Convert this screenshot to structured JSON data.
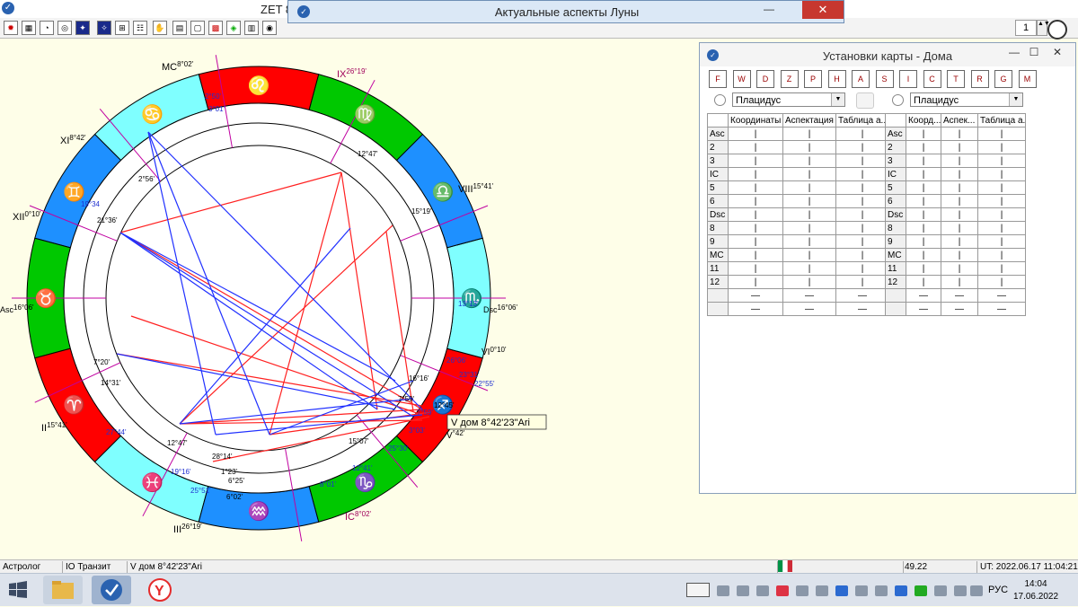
{
  "app": {
    "title": "ZET 8",
    "page_number": "1"
  },
  "moon_window": {
    "title": "Актуальные аспекты Луны",
    "close": "✕",
    "minimize": "—"
  },
  "houses_window": {
    "title": "Установки карты - Дома",
    "minimize": "—",
    "maximize": "☐",
    "close": "✕",
    "buttons": [
      "F",
      "W",
      "D",
      "Z",
      "P",
      "H",
      "A",
      "S",
      "I",
      "C",
      "T",
      "R",
      "G",
      "M"
    ],
    "system_left": "Плацидус",
    "system_right": "Плацидус",
    "left_headers": [
      "Координаты",
      "Аспектация",
      "Таблица а..."
    ],
    "right_headers": [
      "Коорд...",
      "Аспек...",
      "Таблица а..."
    ],
    "rows": [
      "Asc",
      "2",
      "3",
      "IC",
      "5",
      "6",
      "Dsc",
      "8",
      "9",
      "MC",
      "11",
      "12",
      "",
      ""
    ],
    "tick": "|",
    "dash": "—"
  },
  "chart": {
    "cusps": {
      "mc": "MC",
      "mc_deg": "8°02'",
      "ix": "IX",
      "ix_deg": "26°19'",
      "xi": "XI",
      "xi_deg": "8°42'",
      "viii": "VIII",
      "viii_deg": "15°41'",
      "xii": "XII",
      "xii_deg": "0°10'",
      "asc": "Asc",
      "asc_deg": "16°06'",
      "dsc": "Dsc",
      "dsc_deg": "16°06'",
      "vi": "VI",
      "vi_deg": "0°10'",
      "ii": "II",
      "ii_deg": "15°41'",
      "iii": "III",
      "iii_deg": "26°19'",
      "ic": "IC",
      "ic_deg": "8°02'",
      "v": "V",
      "v_deg": "°42'"
    },
    "planet_labels": [
      {
        "text": "2°50'",
        "color": "#1f2fd0"
      },
      {
        "text": "3°01'",
        "color": "#1f2fd0"
      },
      {
        "text": "2°56'",
        "color": "#000"
      },
      {
        "text": "19°34",
        "color": "#1f2fd0"
      },
      {
        "text": "21°36'",
        "color": "#000"
      },
      {
        "text": "12°47'",
        "color": "#000"
      },
      {
        "text": "15°19'",
        "color": "#000"
      },
      {
        "text": "13°13'",
        "color": "#1f2fd0"
      },
      {
        "text": "26°06'",
        "color": "#1f2fd0"
      },
      {
        "text": "23°31'",
        "color": "#1f2fd0"
      },
      {
        "text": "22°55'",
        "color": "#1f2fd0"
      },
      {
        "text": "16°16'",
        "color": "#000"
      },
      {
        "text": "7°59'",
        "color": "#000"
      },
      {
        "text": "12°45'",
        "color": "#000"
      },
      {
        "text": "7°59'",
        "color": "#1f2fd0"
      },
      {
        "text": "3°03'",
        "color": "#1f2fd0"
      },
      {
        "text": "7°20'",
        "color": "#000"
      },
      {
        "text": "14°31'",
        "color": "#000"
      },
      {
        "text": "27°44'",
        "color": "#1f2fd0"
      },
      {
        "text": "12°47'",
        "color": "#000"
      },
      {
        "text": "15°07'",
        "color": "#000"
      },
      {
        "text": "28°14'",
        "color": "#000"
      },
      {
        "text": "1°23'",
        "color": "#000"
      },
      {
        "text": "6°25'",
        "color": "#000"
      },
      {
        "text": "19°16'",
        "color": "#1f2fd0"
      },
      {
        "text": "25°51'",
        "color": "#1f2fd0"
      },
      {
        "text": "6°02'",
        "color": "#000"
      },
      {
        "text": "12°41'",
        "color": "#1f2fd0"
      },
      {
        "text": "8°01'",
        "color": "#1f2fd0"
      },
      {
        "text": "25°30'",
        "color": "#1f2fd0"
      }
    ],
    "tooltip": "V дом  8°42'23\"Ari"
  },
  "status": {
    "s1": "Астролог",
    "s2": "IO Транзит",
    "s3": "V дом  8°42'23\"Ari",
    "s4": "49.22",
    "s5": "UT: 2022.06.17 11:04:21"
  },
  "taskbar": {
    "time": "14:04",
    "date": "17.06.2022",
    "lang": "РУС"
  },
  "colors": {
    "red": "#ff0000",
    "cyan": "#7fffff",
    "green": "#00c800",
    "blue": "#1e90ff",
    "aspect_red": "#ff2020",
    "aspect_blue": "#2030ff"
  }
}
